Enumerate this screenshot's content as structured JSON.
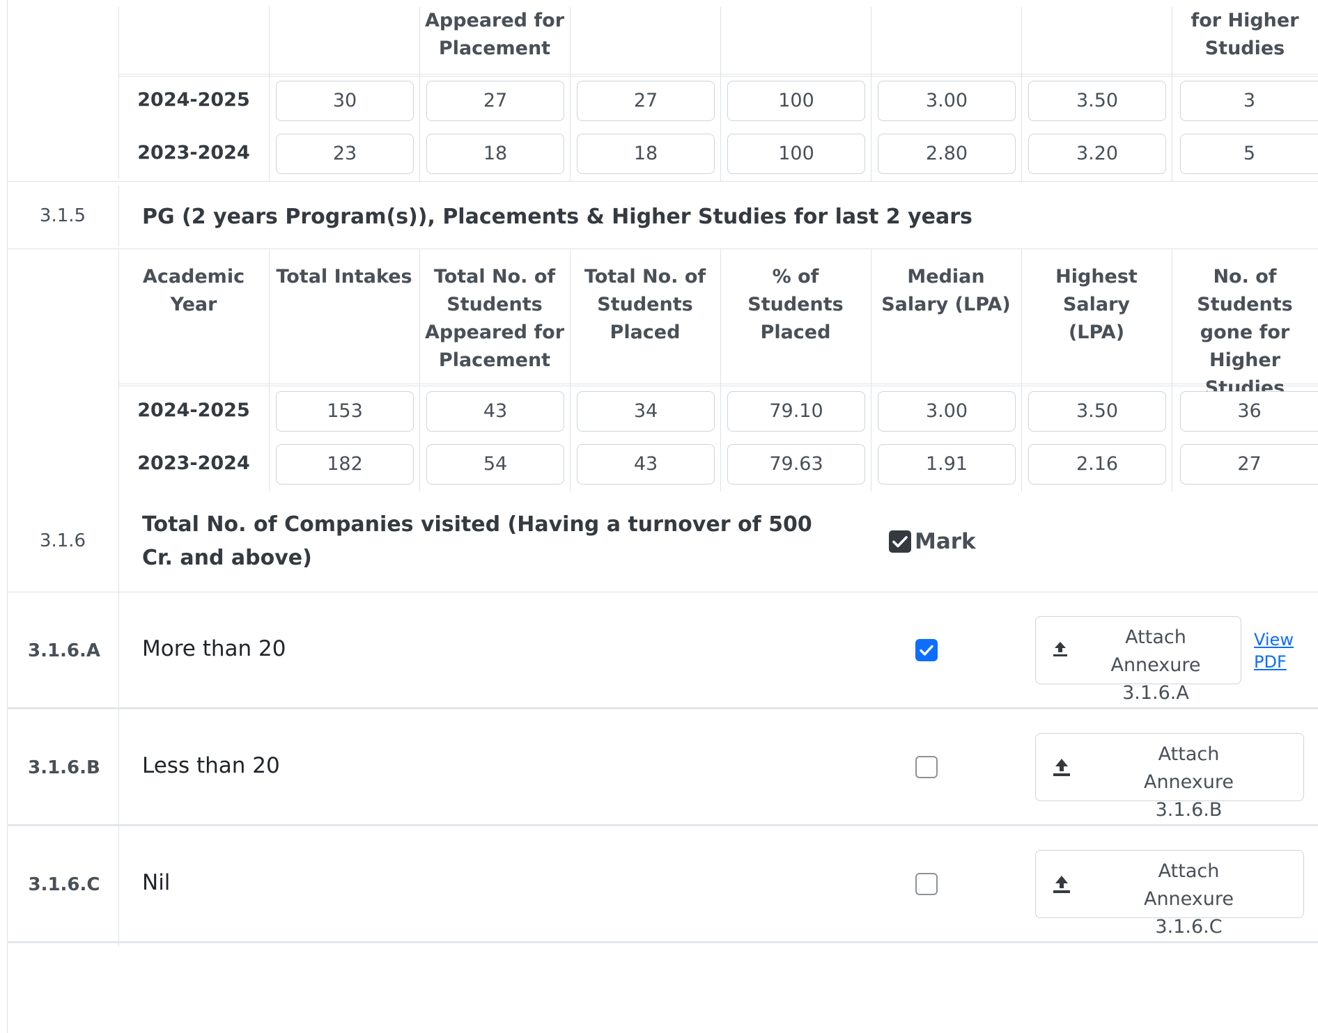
{
  "ug_table": {
    "partial_headers": {
      "appeared": "Appeared for Placement",
      "higher": "for Higher Studies"
    },
    "rows": [
      {
        "year": "2024-2025",
        "values": [
          "30",
          "27",
          "27",
          "100",
          "3.00",
          "3.50",
          "3"
        ]
      },
      {
        "year": "2023-2024",
        "values": [
          "23",
          "18",
          "18",
          "100",
          "2.80",
          "3.20",
          "5"
        ]
      }
    ]
  },
  "section_315": {
    "number": "3.1.5",
    "title": "PG (2 years Program(s)), Placements & Higher Studies for last 2 years",
    "headers": [
      "Academic Year",
      "Total Intakes",
      "Total No. of Students Appeared for Placement",
      "Total No. of Students Placed",
      "% of Students Placed",
      "Median Salary (LPA)",
      "Highest Salary (LPA)",
      "No. of Students gone for Higher Studies"
    ],
    "rows": [
      {
        "year": "2024-2025",
        "values": [
          "153",
          "43",
          "34",
          "79.10",
          "3.00",
          "3.50",
          "36"
        ]
      },
      {
        "year": "2023-2024",
        "values": [
          "182",
          "54",
          "43",
          "79.63",
          "1.91",
          "2.16",
          "27"
        ]
      }
    ]
  },
  "section_316": {
    "number": "3.1.6",
    "title": "Total No. of Companies visited (Having a turnover of 500 Cr. and above)",
    "mark_label": "Mark",
    "mark_checked": true,
    "options": [
      {
        "number": "3.1.6.A",
        "label": "More than 20",
        "checked": true,
        "attach_label": "Attach Annexure 3.1.6.A",
        "view_label": "View PDF"
      },
      {
        "number": "3.1.6.B",
        "label": "Less than 20",
        "checked": false,
        "attach_label": "Attach Annexure 3.1.6.B"
      },
      {
        "number": "3.1.6.C",
        "label": "Nil",
        "checked": false,
        "attach_label": "Attach Annexure 3.1.6.C"
      }
    ]
  },
  "colors": {
    "checkbox_active": "#0d6efd",
    "border": "#dee2e6",
    "link": "#0d6efd"
  },
  "icons": {
    "upload": "upload-icon",
    "check": "check-icon"
  }
}
